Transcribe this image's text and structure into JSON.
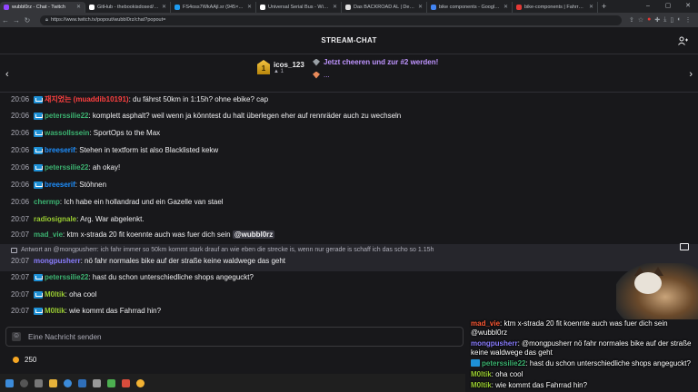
{
  "browser": {
    "tabs": [
      {
        "title": "wubbl0rz - Chat - Twitch",
        "color": "#9146ff",
        "active": true
      },
      {
        "title": "GitHub - thebookisdosed/Vibr...",
        "color": "#ffffff",
        "active": false
      },
      {
        "title": "FS4oss7WkAAjl.sr (945×2048)",
        "color": "#1d9bf0",
        "active": false
      },
      {
        "title": "Universal Serial Bus - Wikipedia",
        "color": "#ffffff",
        "active": false
      },
      {
        "title": "Das BACKROAD AL | Dein Allr...",
        "color": "#e0e0e0",
        "active": false
      },
      {
        "title": "bike components - Google Sear...",
        "color": "#4285f4",
        "active": false
      },
      {
        "title": "bike-components | Fahrradteile...",
        "color": "#e53935",
        "active": false
      }
    ],
    "new_tab": "+",
    "url": "https://www.twitch.tv/popout/wubbl0rz/chat?popout="
  },
  "chat": {
    "title": "STREAM-CHAT",
    "leaderboard": {
      "rank": "1",
      "name": "icos_123",
      "bits": "1",
      "cheer_cta": "Jetzt cheeren und zur #2 werden!",
      "second": "..."
    },
    "messages": [
      {
        "time": "20:06",
        "badge": true,
        "user": "재지었는 (muaddib10191)",
        "color": "#ff4040",
        "text": ": du fährst 50km in 1:15h? ohne ebike? cap"
      },
      {
        "time": "20:06",
        "badge": true,
        "user": "peterssilie22",
        "color": "#3cb371",
        "text": ": komplett asphalt? weil wenn ja könntest du halt überlegen eher auf rennräder auch zu wechseln"
      },
      {
        "time": "20:06",
        "badge": true,
        "user": "wassollssein",
        "color": "#3cb371",
        "text": ": SportOps to the Max"
      },
      {
        "time": "20:06",
        "badge": true,
        "user": "breeserif",
        "color": "#1e90ff",
        "text": ": Stehen in textform ist also Blacklisted kekw"
      },
      {
        "time": "20:06",
        "badge": true,
        "user": "peterssilie22",
        "color": "#3cb371",
        "text": ": ah okay!"
      },
      {
        "time": "20:06",
        "badge": true,
        "user": "breeserif",
        "color": "#1e90ff",
        "text": ": Stöhnen"
      },
      {
        "time": "20:06",
        "badge": false,
        "user": "chermp",
        "color": "#3cb371",
        "text": ": Ich habe ein hollandrad und ein Gazelle van stael"
      },
      {
        "time": "20:07",
        "badge": false,
        "user": "radiosignale",
        "color": "#9acd32",
        "text": ": Arg. War abgelenkt."
      },
      {
        "time": "20:07",
        "badge": false,
        "user": "mad_vie",
        "color": "#3cb371",
        "text": ": ktm x-strada 20 fit koennte auch was fuer dich sein",
        "mention": "@wubbl0rz"
      },
      {
        "time": "20:07",
        "badge": false,
        "user": "mongpusherr",
        "color": "#8a7dff",
        "text": ": nö fahr normales bike auf der straße keine waldwege das geht"
      },
      {
        "time": "20:07",
        "badge": true,
        "user": "peterssilie22",
        "color": "#3cb371",
        "text": ": hast du schon unterschiedliche shops angeguckt?"
      },
      {
        "time": "20:07",
        "badge": true,
        "user": "M0ltik",
        "color": "#9acd32",
        "text": ": oha cool"
      },
      {
        "time": "20:07",
        "badge": true,
        "user": "M0ltik",
        "color": "#9acd32",
        "text": ": wie kommt das Fahrrad hin?"
      }
    ],
    "reply_to": "Antwort an @mongpusherr: ich fahr immer so 50km kommt stark drauf an wie eben die strecke is, wenn nur gerade is schaff ich das scho so 1.15h",
    "input_placeholder": "Eine Nachricht senden",
    "points": "250"
  },
  "overlay": {
    "messages": [
      {
        "user": "mad_vie",
        "color": "#ff5a36",
        "text": ": ktm x-strada 20 fit koennte auch was fuer dich sein @wubbl0rz",
        "badge": false
      },
      {
        "user": "mongpusherr",
        "color": "#8a7dff",
        "text": ": @mongpusherr nö fahr normales bike auf der straße keine waldwege das geht",
        "badge": false
      },
      {
        "user": "peterssilie22",
        "color": "#3cb371",
        "text": ": hast du schon unterschiedliche shops angeguckt?",
        "badge": true
      },
      {
        "user": "M0ltik",
        "color": "#9acd32",
        "text": ": oha cool",
        "badge": false
      },
      {
        "user": "M0ltik",
        "color": "#9acd32",
        "text": ": wie kommt das Fahrrad hin?",
        "badge": false
      }
    ]
  }
}
